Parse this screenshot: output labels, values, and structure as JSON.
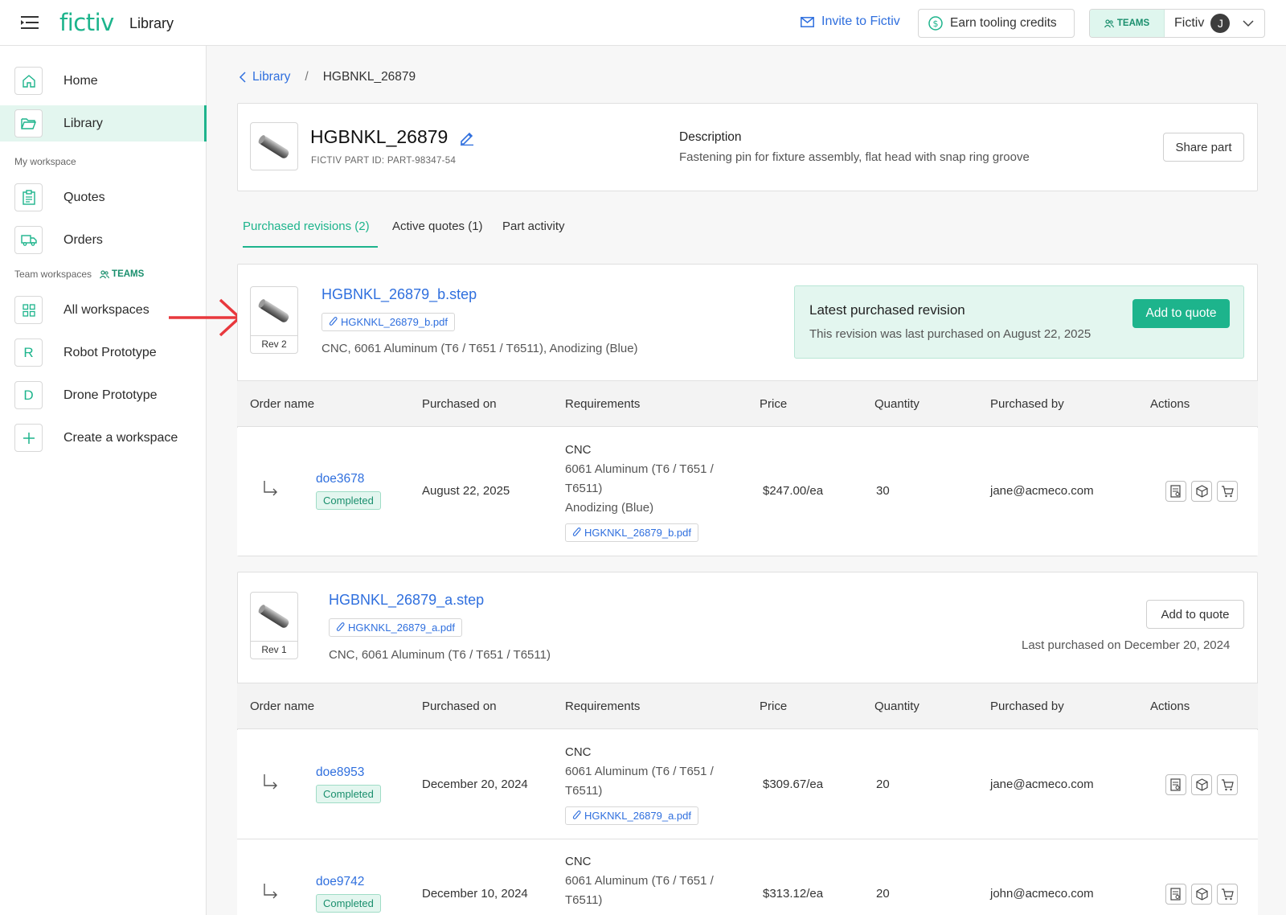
{
  "topbar": {
    "logo": "fictiv",
    "title": "Library",
    "invite_label": "Invite to Fictiv",
    "earn_label": "Earn tooling credits",
    "teams_label": "TEAMS",
    "org_name": "Fictiv",
    "avatar_initial": "J"
  },
  "sidebar": {
    "home": "Home",
    "library": "Library",
    "my_workspace_label": "My workspace",
    "quotes": "Quotes",
    "orders": "Orders",
    "team_workspaces_label": "Team workspaces",
    "teams_label": "TEAMS",
    "all_workspaces": "All workspaces",
    "workspaces": [
      {
        "initial": "R",
        "label": "Robot Prototype"
      },
      {
        "initial": "D",
        "label": "Drone Prototype"
      }
    ],
    "create_workspace": "Create a workspace"
  },
  "breadcrumb": {
    "parent": "Library",
    "current": "HGBNKL_26879"
  },
  "part": {
    "name": "HGBNKL_26879",
    "part_id": "FICTIV PART ID: PART-98347-54",
    "description_label": "Description",
    "description": "Fastening pin for fixture assembly, flat head with snap ring groove",
    "share_label": "Share part"
  },
  "tabs": [
    {
      "label": "Purchased revisions (2)",
      "active": true
    },
    {
      "label": "Active quotes (1)",
      "active": false
    },
    {
      "label": "Part activity",
      "active": false
    }
  ],
  "table_headers": [
    "Order name",
    "Purchased on",
    "Requirements",
    "Price",
    "Quantity",
    "Purchased by",
    "Actions"
  ],
  "revisions": [
    {
      "rev": "Rev 2",
      "file": "HGBNKL_26879_b.step",
      "pdf": "HGKNKL_26879_b.pdf",
      "spec": "CNC, 6061 Aluminum (T6 / T651 / T6511), Anodizing (Blue)",
      "latest_title": "Latest purchased revision",
      "latest_sub": "This revision was last purchased on August 22, 2025",
      "add_label": "Add to quote",
      "orders": [
        {
          "name": "doe3678",
          "status": "Completed",
          "date": "August 22, 2025",
          "req_head": "CNC",
          "req_lines": [
            "6061 Aluminum (T6 / T651 /",
            "T6511)",
            "Anodizing (Blue)"
          ],
          "req_pdf": "HGKNKL_26879_b.pdf",
          "price": "$247.00/ea",
          "qty": "30",
          "by": "jane@acmeco.com"
        }
      ]
    },
    {
      "rev": "Rev 1",
      "file": "HGBNKL_26879_a.step",
      "pdf": "HGKNKL_26879_a.pdf",
      "spec": "CNC, 6061 Aluminum (T6 / T651 / T6511)",
      "last_purchased": "Last purchased on December 20, 2024",
      "add_label": "Add to quote",
      "orders": [
        {
          "name": "doe8953",
          "status": "Completed",
          "date": "December 20, 2024",
          "req_head": "CNC",
          "req_lines": [
            "6061 Aluminum (T6 / T651 /",
            "T6511)"
          ],
          "req_pdf": "HGKNKL_26879_a.pdf",
          "price": "$309.67/ea",
          "qty": "20",
          "by": "jane@acmeco.com"
        },
        {
          "name": "doe9742",
          "status": "Completed",
          "date": "December 10, 2024",
          "req_head": "CNC",
          "req_lines": [
            "6061 Aluminum (T6 / T651 /",
            "T6511)"
          ],
          "price": "$313.12/ea",
          "qty": "20",
          "by": "john@acmeco.com"
        }
      ]
    }
  ],
  "colors": {
    "accent": "#1db48c",
    "link": "#2f6fde",
    "annotation_arrow": "#e8383d"
  }
}
